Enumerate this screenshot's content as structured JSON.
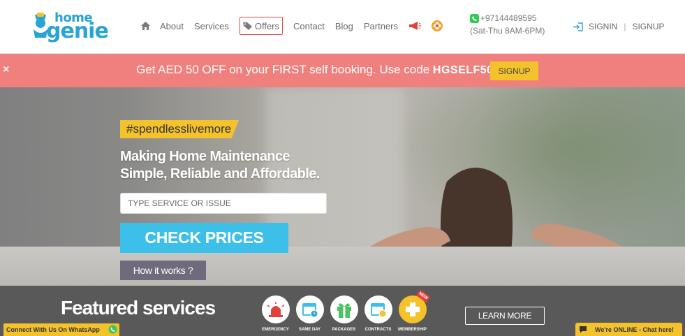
{
  "header": {
    "logo": {
      "line1": "home",
      "line2": "genie"
    },
    "nav": [
      {
        "label": "About"
      },
      {
        "label": "Services"
      },
      {
        "label": "Offers"
      },
      {
        "label": "Contact"
      },
      {
        "label": "Blog"
      },
      {
        "label": "Partners"
      }
    ],
    "icons": [
      "home-icon",
      "tag-icon",
      "megaphone-icon",
      "health-plus-icon"
    ],
    "phone": "+97144489595",
    "hours": "(Sat-Thu 8AM-6PM)",
    "signin": "SIGNIN",
    "separator": "|",
    "signup": "SIGNUP"
  },
  "promo": {
    "close": "×",
    "text_before": "Get AED 50 OFF on your FIRST self booking. Use code ",
    "code": "HGSELF50",
    "text_after": " .",
    "button": "SIGNUP"
  },
  "hero": {
    "tag": "#spendlesslivemore",
    "headline_line1": "Making Home Maintenance",
    "headline_line2": "Simple, Reliable and Affordable.",
    "search_placeholder": "TYPE SERVICE OR ISSUE",
    "check_button": "CHECK PRICES",
    "how_button": "How it works ?"
  },
  "featured": {
    "title": "Featured services",
    "services": [
      {
        "label": "EMERGENCY",
        "icon": "siren-icon"
      },
      {
        "label": "SAME DAY",
        "icon": "calendar-clock-icon"
      },
      {
        "label": "PACKAGES",
        "icon": "gift-icon"
      },
      {
        "label": "CONTRACTS",
        "icon": "calendar-contract-icon"
      },
      {
        "label": "MEMBERSHIP",
        "icon": "plus-icon",
        "badge": "NEW"
      }
    ],
    "learn_more": "LEARN MORE"
  },
  "whatsapp": {
    "label": "Connect With Us On WhatsApp"
  },
  "chat": {
    "label": "We're ONLINE - Chat here!"
  },
  "colors": {
    "brand_blue": "#2aa3d6",
    "promo_bg": "#f0807d",
    "accent_yellow": "#f4c22b",
    "cta_blue": "#3cbfe8",
    "featured_bg": "#595959"
  }
}
